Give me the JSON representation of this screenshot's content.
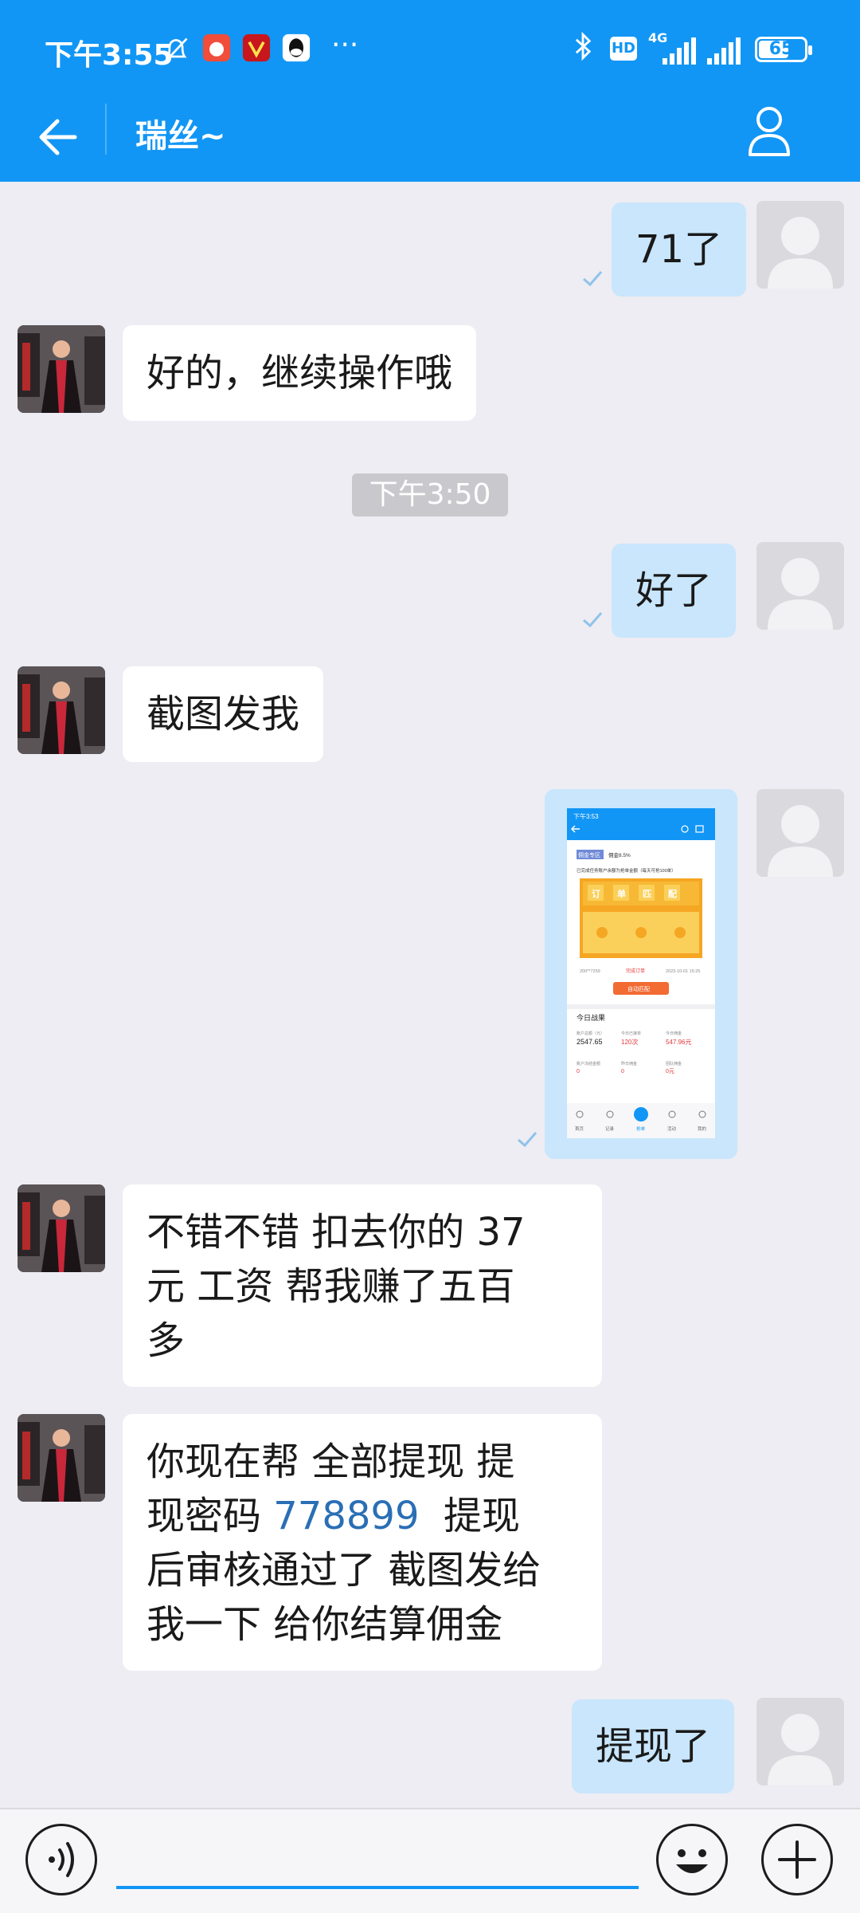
{
  "status_bar": {
    "time": "下午3:55",
    "more": "···",
    "network": "4G",
    "hd": "HD",
    "battery": "65"
  },
  "header": {
    "title": "瑞丝~"
  },
  "messages": [
    {
      "from": "me",
      "text": "71了"
    },
    {
      "from": "other",
      "text": "好的，继续操作哦"
    },
    {
      "from": "system",
      "text": "下午3:50"
    },
    {
      "from": "me",
      "text": "好了"
    },
    {
      "from": "other",
      "text": "截图发我"
    },
    {
      "from": "me",
      "type": "image"
    },
    {
      "from": "other",
      "lines": [
        "不错不错 扣去你的 37",
        "元 工资  帮我赚了五百",
        "多"
      ]
    },
    {
      "from": "other",
      "lines_a": [
        "你现在帮 全部提现  提",
        "现密码 "
      ],
      "password": "778899",
      "lines_b": [
        "  提现",
        "后审核通过了 截图发给",
        "我一下 给你结算佣金"
      ]
    },
    {
      "from": "me",
      "text": "提现了"
    }
  ],
  "screenshot": {
    "time": "下午3:53",
    "tag": "佣金专区",
    "tag_rate": "佣金8.5%",
    "notice": "已完成任务账户余额为抢单金额（每天可抢100单）",
    "match_chars": [
      "订",
      "单",
      "匹",
      "配"
    ],
    "tab_left": "200**7259",
    "tab_mid": "完成订单",
    "tab_right": "2023-10-01 15:25",
    "match_button": "自动匹配",
    "section": "今日战果",
    "stats": [
      {
        "label": "账户总额（元）",
        "value": "2547.65"
      },
      {
        "label": "今日已接单",
        "value": "120次"
      },
      {
        "label": "今日佣金",
        "value": "547.96元"
      },
      {
        "label": "账户冻结金额",
        "value": "0"
      },
      {
        "label": "昨日佣金",
        "value": "0"
      },
      {
        "label": "团队佣金",
        "value": "0元"
      }
    ],
    "tabs": [
      "首页",
      "记录",
      "抢单",
      "活动",
      "我的"
    ]
  },
  "input": {
    "placeholder": ""
  },
  "colors": {
    "brand": "#1296f5",
    "bubble_me": "#c9e6fc",
    "bubble_other": "#ffffff",
    "background": "#ededf3",
    "password": "#2a6fb5"
  },
  "icons": {
    "back": "arrow-left-icon",
    "profile": "person-icon",
    "voice": "voice-icon",
    "emoji": "smile-icon",
    "plus": "plus-icon"
  }
}
